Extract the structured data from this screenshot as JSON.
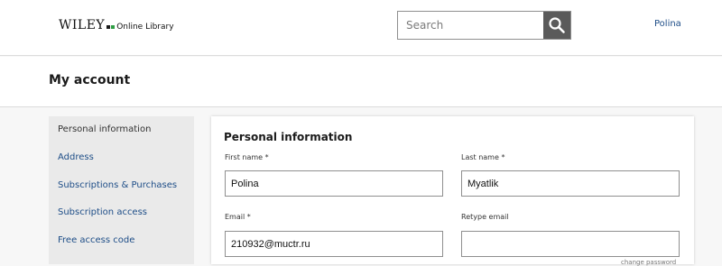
{
  "header": {
    "logo_brand": "WILEY",
    "logo_product": "Online Library",
    "search_placeholder": "Search",
    "user_name": "Polina"
  },
  "page": {
    "title": "My account"
  },
  "sidebar": {
    "items": [
      {
        "label": "Personal information",
        "active": true
      },
      {
        "label": "Address",
        "active": false
      },
      {
        "label": "Subscriptions & Purchases",
        "active": false
      },
      {
        "label": "Subscription access",
        "active": false
      },
      {
        "label": "Free access code",
        "active": false
      }
    ]
  },
  "form": {
    "title": "Personal information",
    "first_name_label": "First name *",
    "first_name_value": "Polina",
    "last_name_label": "Last name *",
    "last_name_value": "Myatlik",
    "email_label": "Email *",
    "email_value": "210932@muctr.ru",
    "retype_email_label": "Retype email",
    "retype_email_value": "",
    "change_password_label": "change password"
  },
  "colors": {
    "link": "#1d4d87",
    "search_button": "#5a5a5a",
    "logo_accent": "#2f9e44"
  },
  "icons": {
    "search": "search-icon"
  }
}
